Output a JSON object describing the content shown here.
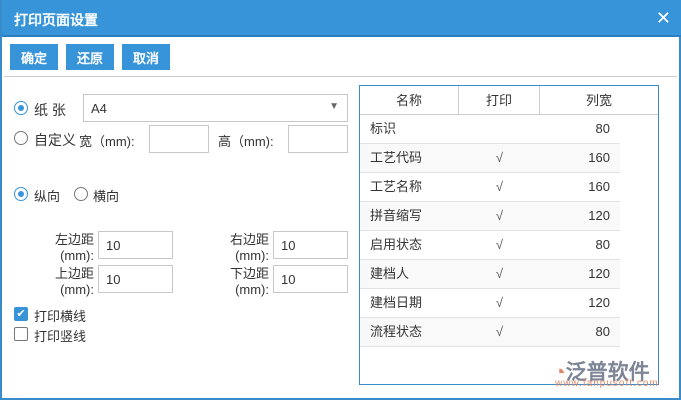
{
  "title": "打印页面设置",
  "toolbar": {
    "ok": "确定",
    "reset": "还原",
    "cancel": "取消"
  },
  "paper": {
    "label": "纸 张",
    "value": "A4"
  },
  "custom": {
    "label": "自定义",
    "width_label": "宽（mm):",
    "height_label": "高（mm):",
    "width": "",
    "height": ""
  },
  "orientation": {
    "portrait": "纵向",
    "landscape": "横向"
  },
  "margins": {
    "left_label": "左边距\n(mm):",
    "left": "10",
    "right_label": "右边距\n(mm):",
    "right": "10",
    "top_label": "上边距\n(mm):",
    "top": "10",
    "bottom_label": "下边距\n(mm):",
    "bottom": "10"
  },
  "options": {
    "hlines": "打印横线",
    "vlines": "打印竖线"
  },
  "table": {
    "headers": [
      "名称",
      "打印",
      "列宽"
    ],
    "rows": [
      [
        "标识",
        "",
        "80"
      ],
      [
        "工艺代码",
        "√",
        "160"
      ],
      [
        "工艺名称",
        "√",
        "160"
      ],
      [
        "拼音缩写",
        "√",
        "120"
      ],
      [
        "启用状态",
        "√",
        "80"
      ],
      [
        "建档人",
        "√",
        "120"
      ],
      [
        "建档日期",
        "√",
        "120"
      ],
      [
        "流程状态",
        "√",
        "80"
      ]
    ]
  },
  "logo": {
    "name": "泛普软件",
    "url": "www.fanpusoft.com"
  }
}
